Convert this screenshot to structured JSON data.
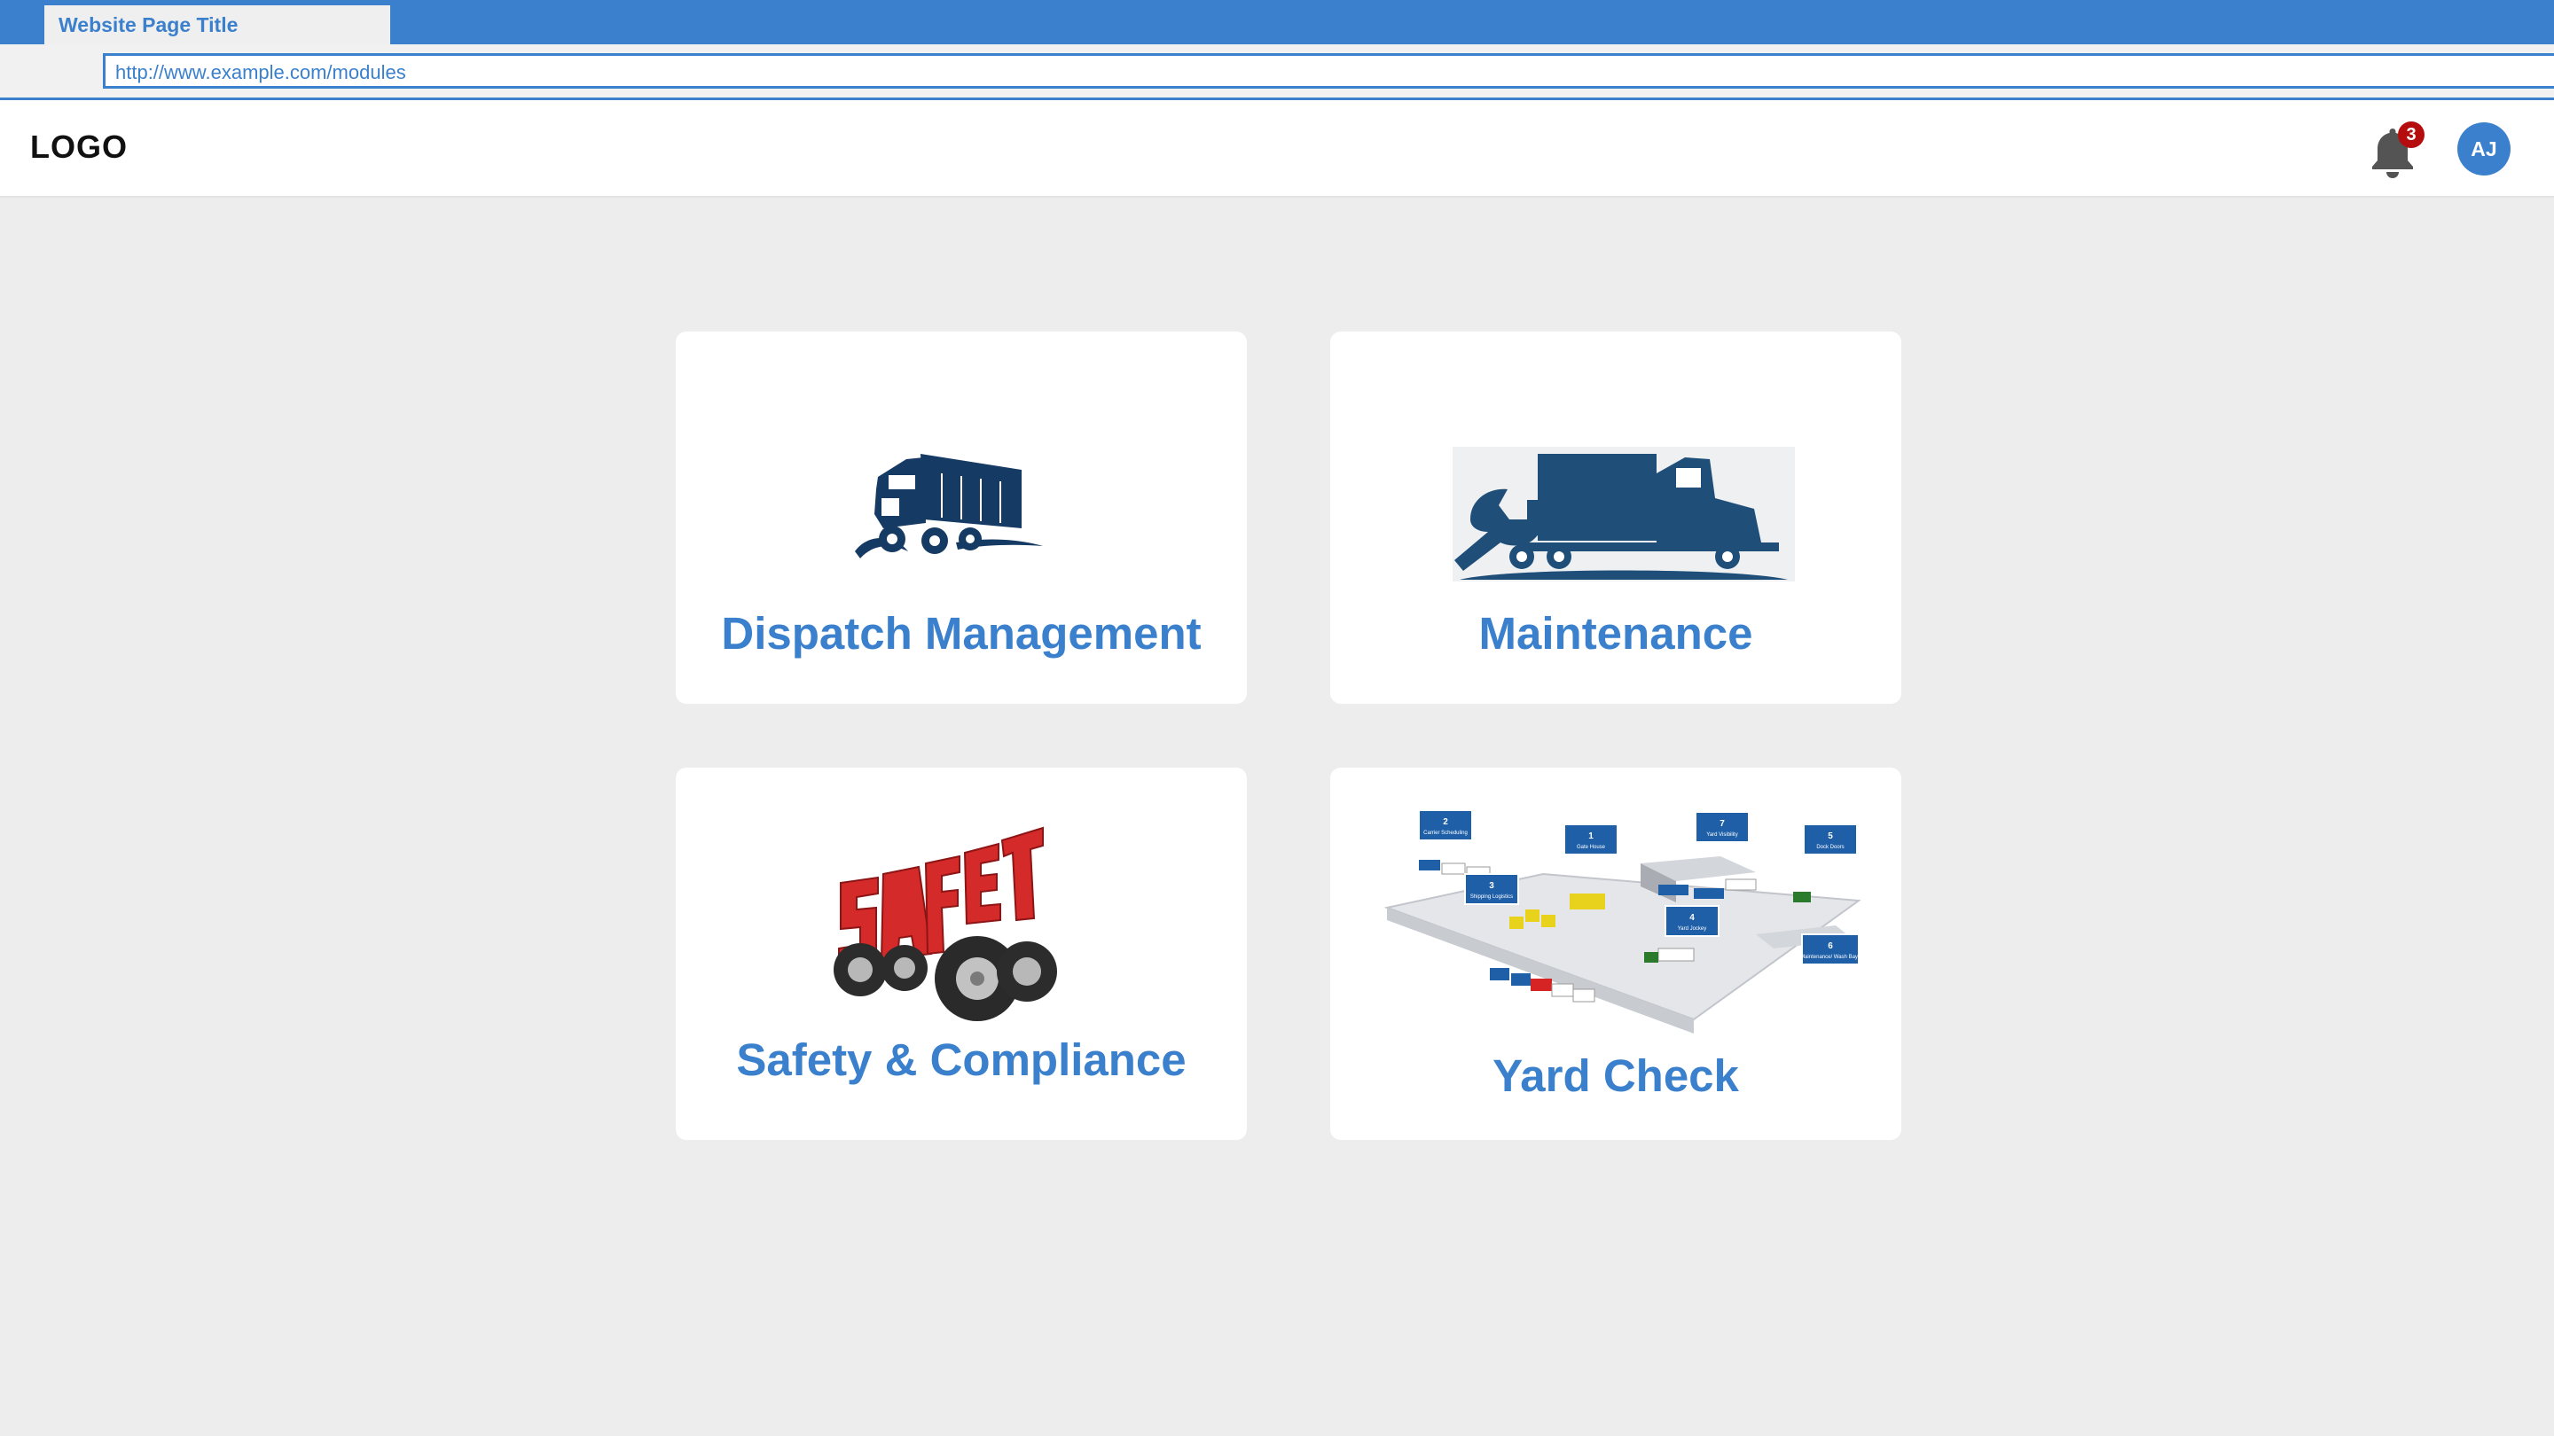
{
  "browser": {
    "tab_title": "Website Page Title",
    "url": "http://www.example.com/modules"
  },
  "header": {
    "logo_text": "LOGO",
    "notification_count": "3",
    "user_initials": "AJ"
  },
  "modules": [
    {
      "label": "Dispatch Management",
      "icon": "semi-truck-icon"
    },
    {
      "label": "Maintenance",
      "icon": "truck-wrench-icon"
    },
    {
      "label": "Safety & Compliance",
      "icon": "safety-wheels-image"
    },
    {
      "label": "Yard Check",
      "icon": "yard-layout-image"
    }
  ],
  "yard_map_labels": [
    {
      "number": "1",
      "text": "Gate House"
    },
    {
      "number": "2",
      "text": "Carrier Scheduling"
    },
    {
      "number": "3",
      "text": "Shipping Logistics"
    },
    {
      "number": "4",
      "text": "Yard Jockey"
    },
    {
      "number": "5",
      "text": "Dock Doors"
    },
    {
      "number": "6",
      "text": "Maintenance/ Wash Bays"
    },
    {
      "number": "7",
      "text": "Yard Visibility"
    }
  ],
  "colors": {
    "accent": "#3b80cc",
    "icon_navy": "#153a63",
    "badge": "#b50d0d",
    "safety_red": "#d42a2a",
    "page_bg": "#ededed"
  }
}
